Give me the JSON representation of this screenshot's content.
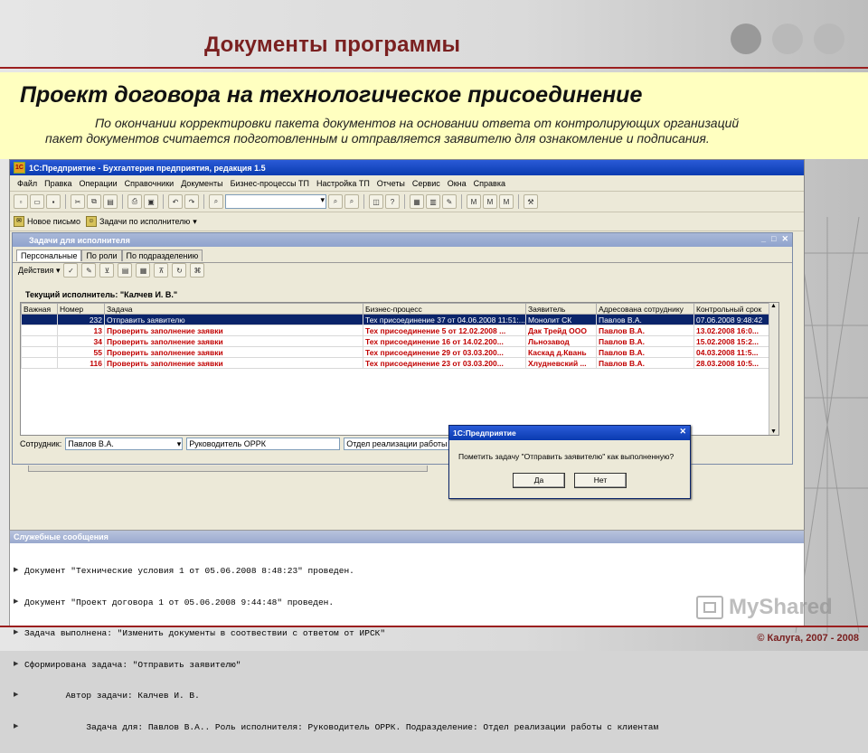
{
  "slide": {
    "title": "Документы программы",
    "heading": "Проект договора на технологическое присоединение",
    "description_line1": "По окончании корректировки пакета документов на основании ответа от контролирующих организаций",
    "description_line2": "пакет документов считается подготовленным и отправляется заявителю для ознакомление и подписания.",
    "copyright": "© Калуга, 2007 - 2008",
    "watermark": "MyShared",
    "colors": {
      "accent": "#7a2020",
      "band": "#ffffc0"
    }
  },
  "app": {
    "window_title": "1С:Предприятие - Бухгалтерия предприятия, редакция 1.5",
    "menu": [
      "Файл",
      "Правка",
      "Операции",
      "Справочники",
      "Документы",
      "Бизнес-процессы ТП",
      "Настройка ТП",
      "Отчеты",
      "Сервис",
      "Окна",
      "Справка"
    ],
    "toolbar2": {
      "new_letter": "Новое письмо",
      "tasks_by_executor": "Задачи по исполнителю"
    }
  },
  "tasks_window": {
    "title": "Задачи для исполнителя",
    "tabs": [
      "Персональные",
      "По роли",
      "По подразделению"
    ],
    "actions_label": "Действия",
    "current_executor": "Текущий исполнитель: \"Калчев И. В.\"",
    "columns": [
      "Важная",
      "Номер",
      "Задача",
      "Бизнес-процесс",
      "Заявитель",
      "Адресована сотруднику",
      "Контрольный срок"
    ],
    "rows": [
      {
        "important": "",
        "number": "232",
        "task": "Отправить заявителю",
        "process": "Тех присоединение 37 от 04.06.2008 11:51:...",
        "applicant": "Монолит СК",
        "employee": "Павлов В.А.",
        "deadline": "07.06.2008 9:48:42"
      },
      {
        "important": "",
        "number": "13",
        "task": "Проверить заполнение заявки",
        "process": "Тех присоединение 5 от 12.02.2008 ...",
        "applicant": "Дак Трейд ООО",
        "employee": "Павлов В.А.",
        "deadline": "13.02.2008 16:0..."
      },
      {
        "important": "",
        "number": "34",
        "task": "Проверить заполнение заявки",
        "process": "Тех присоединение 16 от 14.02.200...",
        "applicant": "Льнозавод",
        "employee": "Павлов В.А.",
        "deadline": "15.02.2008 15:2..."
      },
      {
        "important": "",
        "number": "55",
        "task": "Проверить заполнение заявки",
        "process": "Тех присоединение 29 от 03.03.200...",
        "applicant": "Каскад д.Квань",
        "employee": "Павлов В.А.",
        "deadline": "04.03.2008 11:5..."
      },
      {
        "important": "",
        "number": "116",
        "task": "Проверить заполнение заявки",
        "process": "Тех присоединение 23 от 03.03.200...",
        "applicant": "Хлудневский ...",
        "employee": "Павлов В.А.",
        "deadline": "28.03.2008 10:5..."
      }
    ],
    "employee_label": "Сотрудник:",
    "employee_value": "Павлов В.А.",
    "role_value": "Руководитель ОРРК",
    "department_value": "Отдел реализации работы с к"
  },
  "dialog": {
    "title": "1С:Предприятие",
    "message": "Пометить задачу \"Отправить заявителю\" как выполненную?",
    "yes": "Да",
    "no": "Нет"
  },
  "messages": {
    "title": "Служебные сообщения",
    "lines": [
      "Документ \"Технические условия 1 от 05.06.2008 8:48:23\" проведен.",
      "Документ \"Проект договора 1 от 05.06.2008 9:44:48\" проведен.",
      "Задача выполнена: \"Изменить документы в соотвествии с ответом от ИРСК\"",
      "Сформирована задача: \"Отправить заявителю\"",
      "        Автор задачи: Калчев И. В.",
      "            Задача для: Павлов В.А.. Роль исполнителя: Руководитель ОРРК. Подразделение: Отдел реализации работы с клиентам"
    ]
  }
}
